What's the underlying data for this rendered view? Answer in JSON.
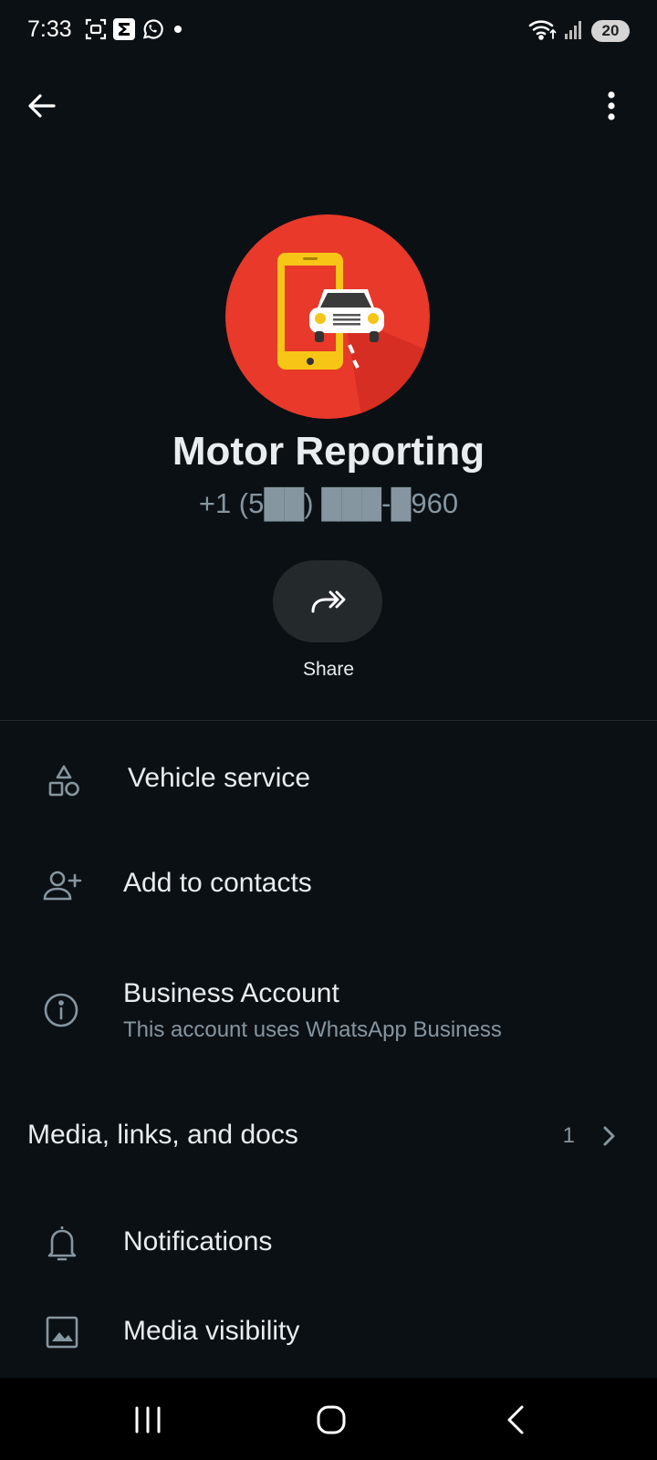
{
  "status_bar": {
    "time": "7:33",
    "left_icons": [
      "screenshot-icon",
      "sigma-app-icon",
      "whatsapp-icon",
      "dot-icon"
    ],
    "right_icons": [
      "wifi-icon",
      "signal-icon"
    ],
    "battery": "20"
  },
  "header": {
    "back_icon": "arrow-left-icon",
    "menu_icon": "more-vertical-icon"
  },
  "profile": {
    "name": "Motor Reporting",
    "phone": "+1 (5██) ███-█960",
    "avatar_icon": "phone-car-logo",
    "avatar_color": "#e8392b"
  },
  "share": {
    "label": "Share",
    "icon": "forward-arrow-icon"
  },
  "rows": {
    "category": {
      "label": "Vehicle service",
      "icon": "category-shapes-icon"
    },
    "add_contact": {
      "label": "Add to contacts",
      "icon": "person-add-icon"
    },
    "business": {
      "label": "Business Account",
      "sub": "This account uses WhatsApp Business",
      "icon": "info-icon"
    },
    "media": {
      "label": "Media, links, and docs",
      "count": "1",
      "icon": "chevron-right-icon"
    },
    "notifications": {
      "label": "Notifications",
      "icon": "bell-icon"
    },
    "media_visibility": {
      "label": "Media visibility",
      "icon": "image-icon"
    }
  },
  "nav": {
    "icons": [
      "recents-icon",
      "home-icon",
      "back-icon"
    ]
  },
  "colors": {
    "background": "#0b1014",
    "primary_text": "#e9edef",
    "secondary_text": "#8696a0",
    "share_bg": "#24292c"
  }
}
